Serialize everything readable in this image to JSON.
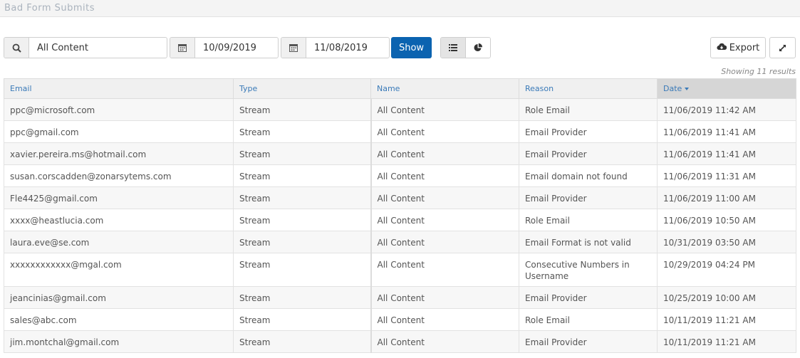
{
  "page": {
    "title": "Bad Form Submits"
  },
  "filters": {
    "search_value": "All Content",
    "start_date": "10/09/2019",
    "end_date": "11/08/2019",
    "show_label": "Show",
    "export_label": "Export"
  },
  "results": {
    "summary": "Showing 11 results"
  },
  "table": {
    "columns": [
      "Email",
      "Type",
      "Name",
      "Reason",
      "Date"
    ],
    "sorted_column": "Date",
    "rows": [
      {
        "email": "ppc@microsoft.com",
        "type": "Stream",
        "name": "All Content",
        "reason": "Role Email",
        "date": "11/06/2019 11:42 AM"
      },
      {
        "email": "ppc@gmail.com",
        "type": "Stream",
        "name": "All Content",
        "reason": "Email Provider",
        "date": "11/06/2019 11:41 AM"
      },
      {
        "email": "xavier.pereira.ms@hotmail.com",
        "type": "Stream",
        "name": "All Content",
        "reason": "Email Provider",
        "date": "11/06/2019 11:41 AM"
      },
      {
        "email": "susan.corscadden@zonarsytems.com",
        "type": "Stream",
        "name": "All Content",
        "reason": "Email domain not found",
        "date": "11/06/2019 11:31 AM"
      },
      {
        "email": "Fle4425@gmail.com",
        "type": "Stream",
        "name": "All Content",
        "reason": "Email Provider",
        "date": "11/06/2019 11:00 AM"
      },
      {
        "email": "xxxx@heastlucia.com",
        "type": "Stream",
        "name": "All Content",
        "reason": "Role Email",
        "date": "11/06/2019 10:50 AM"
      },
      {
        "email": "laura.eve@se.com",
        "type": "Stream",
        "name": "All Content",
        "reason": "Email Format is not valid",
        "date": "10/31/2019 03:50 AM"
      },
      {
        "email": "xxxxxxxxxxxx@mgal.com",
        "type": "Stream",
        "name": "All Content",
        "reason": "Consecutive Numbers in Username",
        "date": "10/29/2019 04:24 PM"
      },
      {
        "email": "jeancinias@gmail.com",
        "type": "Stream",
        "name": "All Content",
        "reason": "Email Provider",
        "date": "10/25/2019 10:00 AM"
      },
      {
        "email": "sales@abc.com",
        "type": "Stream",
        "name": "All Content",
        "reason": "Role Email",
        "date": "10/11/2019 11:21 AM"
      },
      {
        "email": "jim.montchal@gmail.com",
        "type": "Stream",
        "name": "All Content",
        "reason": "Email Provider",
        "date": "10/11/2019 11:21 AM"
      }
    ]
  },
  "colors": {
    "primary": "#0b63b0",
    "header_link": "#3a7ab8",
    "sorted_header_bg": "#d6d6d6"
  },
  "icons": [
    "search-icon",
    "calendar-icon",
    "list-view-icon",
    "pie-chart-icon",
    "cloud-download-icon",
    "expand-icon"
  ]
}
